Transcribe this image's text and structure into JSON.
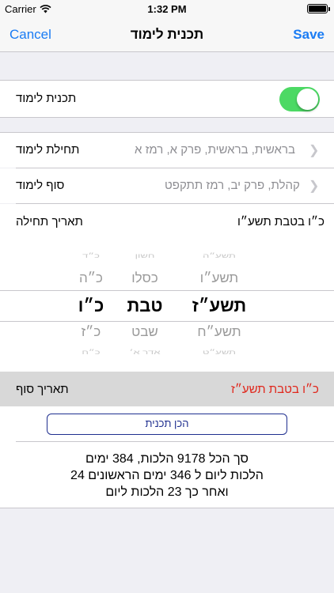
{
  "status_bar": {
    "carrier": "Carrier",
    "time": "1:32 PM"
  },
  "nav": {
    "cancel": "Cancel",
    "title": "תכנית לימוד",
    "save": "Save"
  },
  "study_plan_toggle": {
    "label": "תכנית לימוד",
    "on": true
  },
  "start_row": {
    "label": "תחילת לימוד",
    "value": "בראשית, בראשית, פרק א, רמז א"
  },
  "end_row": {
    "label": "סוף לימוד",
    "value": "קהלת, פרק יב, רמז תתקפט"
  },
  "start_date_row": {
    "label": "תאריך תחילה",
    "value": "כ״ו בטבת תשע״ו"
  },
  "picker": {
    "years": [
      "תשע״ה",
      "תשע״ו",
      "תשע״ז",
      "תשע״ח",
      "תשע״ט"
    ],
    "months": [
      "חשון",
      "כסלו",
      "טבת",
      "שבט",
      "אדר א׳"
    ],
    "days": [
      "כ״ד",
      "כ״ה",
      "כ״ו",
      "כ״ז",
      "כ״ח"
    ]
  },
  "end_date_row": {
    "label": "תאריך סוף",
    "value": "כ״ו בטבת תשע״ז",
    "value_color": "#e0261b"
  },
  "build_button": "הכן תכנית",
  "summary": {
    "line1": "סך הכל 9178 הלכות, 384 ימים",
    "line2": "24 הלכות ליום ל 346 ימים הראשונים",
    "line3": "ואחר כך 23 הלכות ליום"
  },
  "colors": {
    "accent": "#1a7cf4",
    "toggle_on": "#4cd964",
    "end_date": "#e0261b"
  },
  "icons": [
    "wifi-icon",
    "battery-icon",
    "chevron-right-icon"
  ]
}
